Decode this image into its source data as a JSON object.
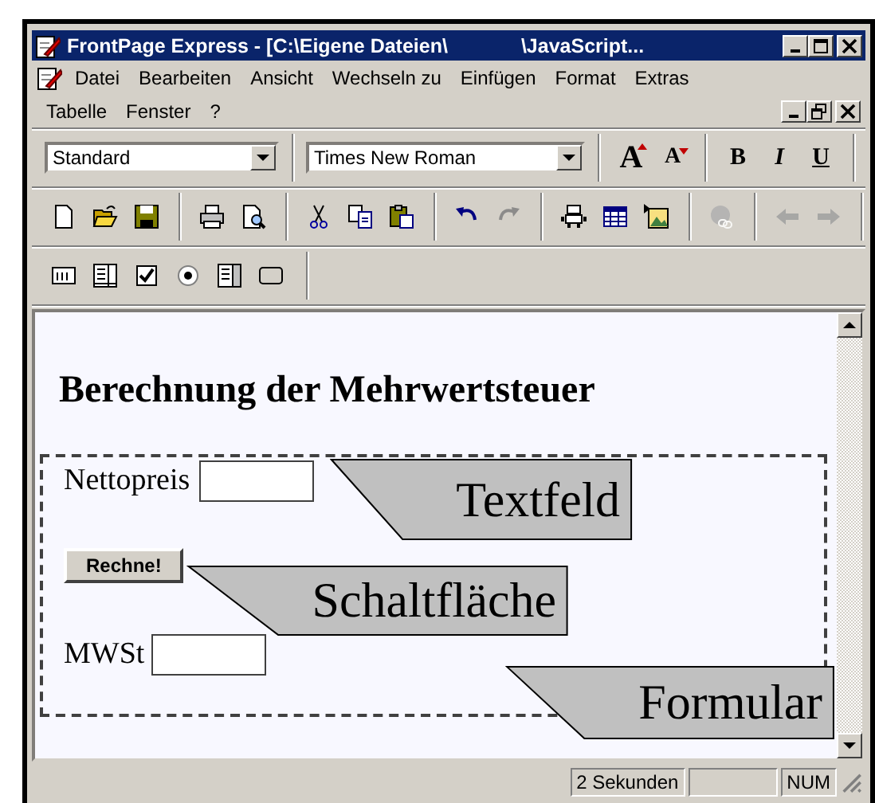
{
  "window": {
    "title_parts": [
      "FrontPage Express - [C:\\Eigene Dateien\\",
      "\\JavaScript..."
    ]
  },
  "menu_rows": [
    [
      "Datei",
      "Bearbeiten",
      "Ansicht",
      "Wechseln zu",
      "Einfügen",
      "Format",
      "Extras"
    ],
    [
      "Tabelle",
      "Fenster",
      "?"
    ]
  ],
  "format_bar": {
    "style": "Standard",
    "font": "Times New Roman",
    "grow_font": "A",
    "shrink_font": "A",
    "bold": "B",
    "italic": "I",
    "underline": "U"
  },
  "toolbar_groups": [
    [
      {
        "kind": "new",
        "disabled": false
      },
      {
        "kind": "open",
        "disabled": false
      },
      {
        "kind": "save",
        "disabled": false
      }
    ],
    [
      {
        "kind": "print",
        "disabled": false
      },
      {
        "kind": "preview",
        "disabled": false
      }
    ],
    [
      {
        "kind": "cut",
        "disabled": false
      },
      {
        "kind": "copy",
        "disabled": false
      },
      {
        "kind": "paste",
        "disabled": false
      }
    ],
    [
      {
        "kind": "undo",
        "disabled": false
      },
      {
        "kind": "redo",
        "disabled": true
      }
    ],
    [
      {
        "kind": "bot",
        "disabled": false
      },
      {
        "kind": "table",
        "disabled": false
      },
      {
        "kind": "image",
        "disabled": false
      }
    ],
    [
      {
        "kind": "link",
        "disabled": true
      }
    ],
    [
      {
        "kind": "back",
        "disabled": true
      },
      {
        "kind": "forward",
        "disabled": true
      }
    ]
  ],
  "form_bar": [
    {
      "kind": "textbox"
    },
    {
      "kind": "textarea"
    },
    {
      "kind": "checkbox"
    },
    {
      "kind": "radio"
    },
    {
      "kind": "dropdown"
    },
    {
      "kind": "pushbutton"
    }
  ],
  "document": {
    "heading": "Berechnung der Mehrwertsteuer",
    "fields": [
      {
        "label": "Nettopreis"
      },
      {
        "label": "MWSt"
      }
    ],
    "button": "Rechne!"
  },
  "callouts": [
    {
      "text": "Textfeld"
    },
    {
      "text": "Schaltfläche"
    },
    {
      "text": "Formular"
    }
  ],
  "status_bar": {
    "time": "2 Sekunden",
    "mode": "NUM"
  }
}
